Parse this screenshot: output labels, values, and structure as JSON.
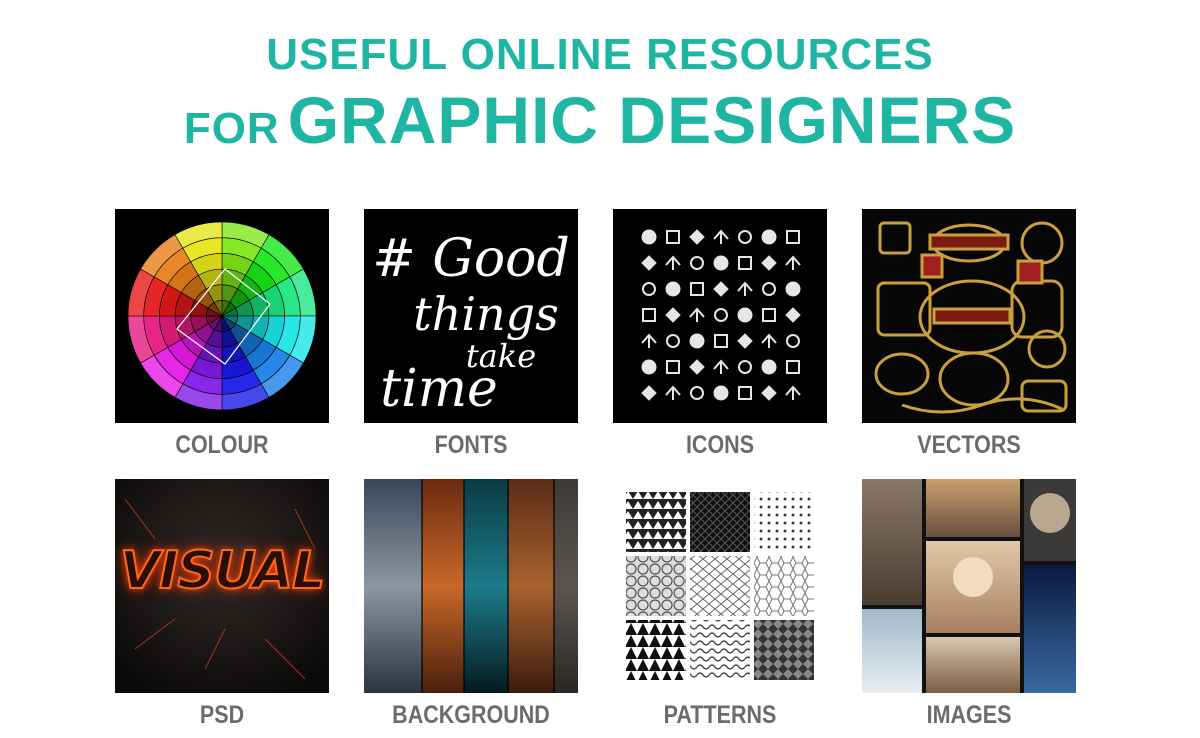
{
  "header": {
    "line1": "USEFUL ONLINE RESOURCES",
    "line2_prefix": "FOR",
    "line2_main": "GRAPHIC DESIGNERS"
  },
  "colors": {
    "accent": "#1fb5a3",
    "label": "#6b6b69",
    "tile_background": "#000000"
  },
  "tiles": [
    {
      "label": "COLOUR",
      "icon": "color-wheel-icon"
    },
    {
      "label": "FONTS",
      "icon": "typography-icon"
    },
    {
      "label": "ICONS",
      "icon": "icon-set-icon"
    },
    {
      "label": "VECTORS",
      "icon": "vector-badges-icon"
    },
    {
      "label": "PSD",
      "icon": "text-effect-icon"
    },
    {
      "label": "BACKGROUND",
      "icon": "texture-strips-icon"
    },
    {
      "label": "PATTERNS",
      "icon": "pattern-grid-icon"
    },
    {
      "label": "IMAGES",
      "icon": "photo-collage-icon"
    }
  ],
  "fonts_art": {
    "line1": "# Good",
    "line2": "things",
    "line3": "take",
    "line4": "time"
  },
  "psd_art": {
    "text": "VISUAL"
  }
}
